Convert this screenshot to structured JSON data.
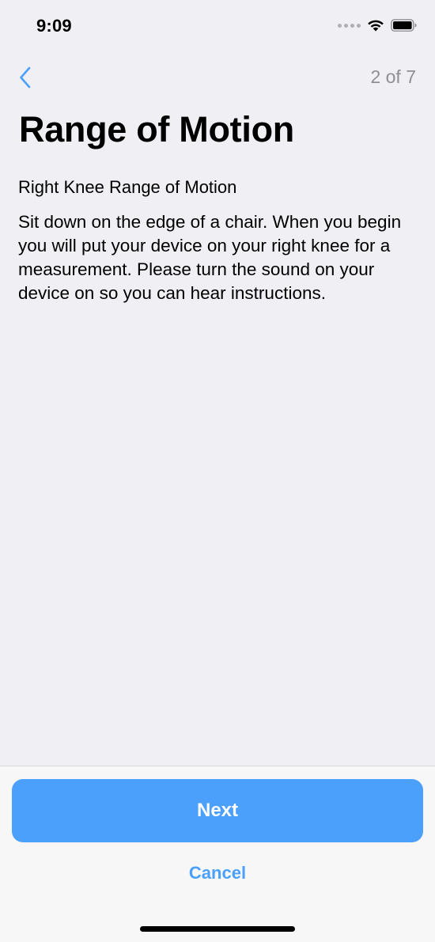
{
  "status_bar": {
    "time": "9:09",
    "icons": [
      "signal-dots-icon",
      "wifi-icon",
      "battery-icon"
    ]
  },
  "nav": {
    "back_icon": "chevron-left-icon",
    "step": "2 of 7"
  },
  "content": {
    "title": "Range of Motion",
    "subtitle": "Right Knee Range of Motion",
    "body": "Sit down on the edge of a chair. When you begin you will put your device on your right knee for a measurement. Please turn the sound on your device on so you can hear instructions."
  },
  "footer": {
    "next_label": "Next",
    "cancel_label": "Cancel"
  },
  "colors": {
    "accent": "#4aa0fb",
    "background": "#efeff4",
    "footer_background": "#f7f7f7",
    "secondary_text": "#8e8e93"
  }
}
